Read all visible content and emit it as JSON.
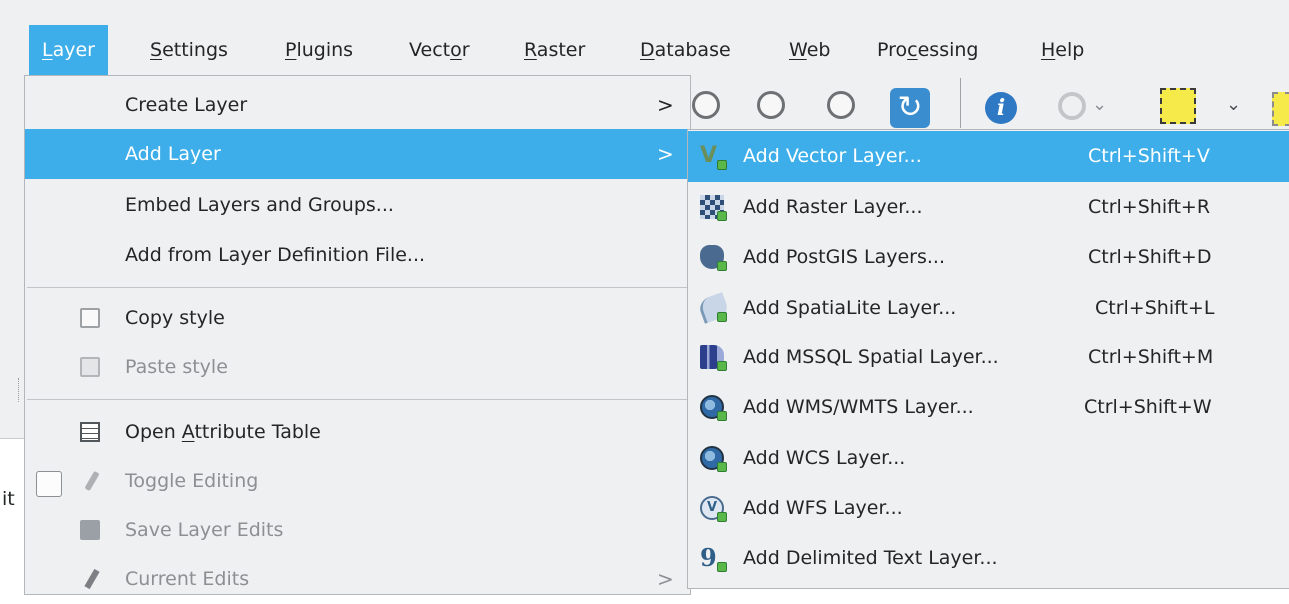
{
  "menubar": {
    "items": [
      {
        "label_under": "L",
        "label_rest": "ayer"
      },
      {
        "label_under": "S",
        "label_rest": "ettings"
      },
      {
        "label_under": "P",
        "label_rest": "lugins"
      },
      {
        "label_pre": "Vect",
        "label_under": "o",
        "label_rest": "r"
      },
      {
        "label_under": "R",
        "label_rest": "aster"
      },
      {
        "label_under": "D",
        "label_rest": "atabase"
      },
      {
        "label_under": "W",
        "label_rest": "eb"
      },
      {
        "label_pre": "Pro",
        "label_under": "c",
        "label_rest": "essing"
      },
      {
        "label_under": "H",
        "label_rest": "elp"
      }
    ]
  },
  "background": {
    "partial_text": "it"
  },
  "layer_menu": {
    "create_layer": "Create Layer",
    "add_layer": "Add Layer",
    "embed_layers": "Embed Layers and Groups...",
    "add_from_definition": "Add from Layer Definition File...",
    "copy_style": "Copy style",
    "paste_style": "Paste style",
    "open_attr_pre": "Open ",
    "open_attr_under": "A",
    "open_attr_rest": "ttribute Table",
    "toggle_editing": "Toggle Editing",
    "save_layer_edits": "Save Layer Edits",
    "current_edits": "Current Edits",
    "submenu_arrow": ">"
  },
  "add_layer_menu": {
    "items": [
      {
        "label": "Add Vector Layer...",
        "shortcut": "Ctrl+Shift+V"
      },
      {
        "label": "Add Raster Layer...",
        "shortcut": "Ctrl+Shift+R"
      },
      {
        "label": "Add PostGIS Layers...",
        "shortcut": "Ctrl+Shift+D"
      },
      {
        "label": "Add SpatiaLite Layer...",
        "shortcut": "Ctrl+Shift+L"
      },
      {
        "label": "Add MSSQL Spatial Layer...",
        "shortcut": "Ctrl+Shift+M"
      },
      {
        "label": "Add WMS/WMTS Layer...",
        "shortcut": "Ctrl+Shift+W"
      },
      {
        "label": "Add WCS Layer...",
        "shortcut": ""
      },
      {
        "label": "Add WFS Layer...",
        "shortcut": ""
      },
      {
        "label": "Add Delimited Text Layer...",
        "shortcut": ""
      }
    ]
  },
  "icons": {
    "toolbar": [
      "zoom-in-icon",
      "zoom-out-icon",
      "zoom-last-icon",
      "zoom-next-icon",
      "refresh-icon",
      "identify-icon",
      "run-action-icon",
      "select-features-icon"
    ],
    "layer_menu": [
      "copy-style-icon",
      "paste-style-icon",
      "attribute-table-icon",
      "toggle-editing-icon",
      "save-edits-icon",
      "current-edits-icon"
    ],
    "add_layer_menu": [
      "vector-layer-icon",
      "raster-layer-icon",
      "postgis-icon",
      "spatialite-icon",
      "mssql-icon",
      "wms-icon",
      "wcs-icon",
      "wfs-icon",
      "delimited-text-icon"
    ]
  },
  "colors": {
    "highlight": "#3daee9",
    "menu_bg": "#eff0f1",
    "text": "#232627",
    "disabled_text": "#8c9093"
  }
}
